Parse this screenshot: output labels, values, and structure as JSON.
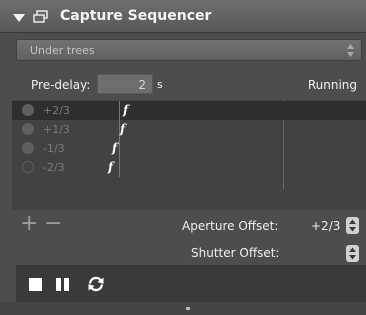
{
  "title": "Capture Sequencer",
  "preset": {
    "selected": "Under trees"
  },
  "pre_delay": {
    "label": "Pre-delay:",
    "value": "2",
    "unit": "s"
  },
  "status": "Running",
  "sequence": [
    {
      "value": "+2/3",
      "marker": "f",
      "dot": "filled",
      "selected": true
    },
    {
      "value": "+1/3",
      "marker": "f",
      "dot": "filled",
      "selected": false
    },
    {
      "value": "-1/3",
      "marker": "f",
      "dot": "filled",
      "selected": false
    },
    {
      "value": "-2/3",
      "marker": "f",
      "dot": "hollow",
      "selected": false
    }
  ],
  "controls": {
    "add": "+",
    "remove": "−",
    "aperture_offset_label": "Aperture Offset:",
    "aperture_offset_value": "+2/3",
    "shutter_offset_label": "Shutter Offset:"
  },
  "icons": {
    "collapse": "triangle-down-icon",
    "window": "window-icon",
    "stop": "stop-icon",
    "pause": "pause-icon",
    "loop": "loop-icon"
  }
}
